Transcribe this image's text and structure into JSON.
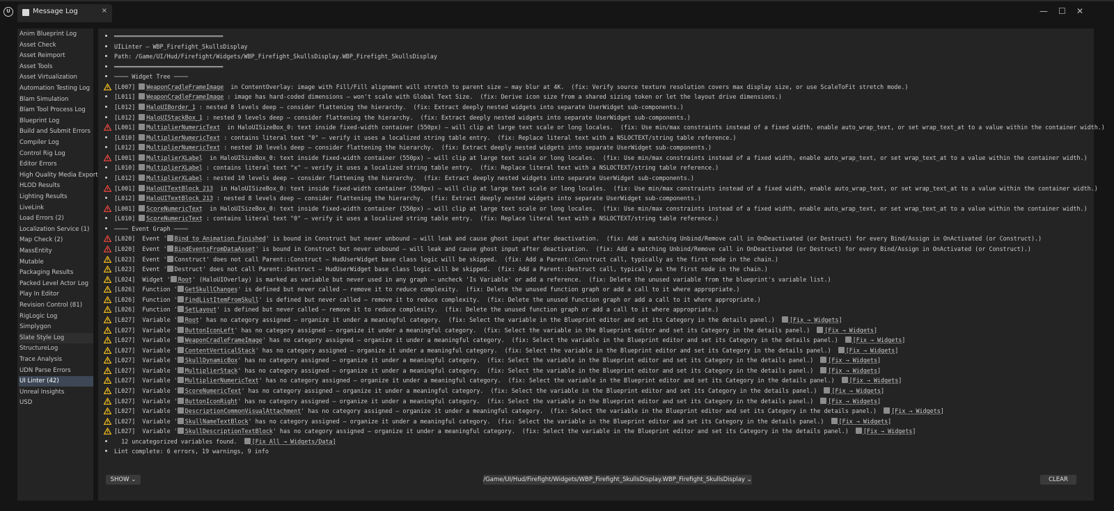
{
  "window": {
    "tab_title": "Message Log",
    "close_glyph": "×",
    "minimize_glyph": "—",
    "maximize_glyph": "☐",
    "window_close_glyph": "✕"
  },
  "sidebar": {
    "selected_index": 32,
    "hover_index": 28,
    "items": [
      "Anim Blueprint Log",
      "Asset Check",
      "Asset Reimport",
      "Asset Tools",
      "Asset Virtualization",
      "Automation Testing Log",
      "Blam Simulation",
      "Blam Tool Process Log",
      "Blueprint Log",
      "Build and Submit Errors",
      "Compiler Log",
      "Control Rig Log",
      "Editor Errors",
      "High Quality Media Export",
      "HLOD Results",
      "Lighting Results",
      "LiveLink",
      "Load Errors (2)",
      "Localization Service (1)",
      "Map Check (2)",
      "MassEntity",
      "Mutable",
      "Packaging Results",
      "Packed Level Actor Log",
      "Play In Editor",
      "Revision Control (81)",
      "RigLogic Log",
      "Simplygon",
      "Slate Style Log",
      "StructureLog",
      "Trace Analysis",
      "UDN Parse Errors",
      "UI Linter (42)",
      "Unreal Insights",
      "USD"
    ]
  },
  "colors": {
    "warning": "#e8b51c",
    "error": "#e0443a",
    "selected_bg": "#3d4756"
  },
  "log": {
    "lines": [
      {
        "t": "b",
        "segs": [
          {
            "x": "═══════════════════════════════"
          }
        ]
      },
      {
        "t": "b",
        "segs": [
          {
            "x": "UILinter — WBP_Firefight_SkullsDisplay"
          }
        ]
      },
      {
        "t": "b",
        "segs": [
          {
            "x": "Path: /Game/UI/Hud/Firefight/Widgets/WBP_Firefight_SkullsDisplay.WBP_Firefight_SkullsDisplay"
          }
        ]
      },
      {
        "t": "b",
        "segs": [
          {
            "x": "═══════════════════════════════"
          }
        ]
      },
      {
        "t": "b",
        "segs": [
          {
            "x": "──── Widget Tree ────"
          }
        ]
      },
      {
        "t": "w",
        "segs": [
          {
            "x": "[L007] "
          },
          {
            "i": 1
          },
          {
            "x": "WeaponCradleFrameImage",
            "u": 1
          },
          {
            "x": "  in ContentOverlay: image with Fill/Fill alignment will stretch to parent size — may blur at 4K.  (fix: Verify source texture resolution covers max display size, or use ScaleToFit stretch mode.)"
          }
        ]
      },
      {
        "t": "b",
        "segs": [
          {
            "x": "[L011] "
          },
          {
            "i": 1
          },
          {
            "x": "WeaponCradleFrameImage",
            "u": 1
          },
          {
            "x": " : image has hard-coded dimensions — won't scale with Global Text Size.  (fix: Derive icon size from a shared sizing token or let the layout drive dimensions.)"
          }
        ]
      },
      {
        "t": "b",
        "segs": [
          {
            "x": "[L012] "
          },
          {
            "i": 1
          },
          {
            "x": "HaloUIBorder_1",
            "u": 1
          },
          {
            "x": " : nested 8 levels deep — consider flattening the hierarchy.  (fix: Extract deeply nested widgets into separate UserWidget sub-components.)"
          }
        ]
      },
      {
        "t": "b",
        "segs": [
          {
            "x": "[L012] "
          },
          {
            "i": 1
          },
          {
            "x": "HaloUIStackBox_1",
            "u": 1
          },
          {
            "x": " : nested 9 levels deep — consider flattening the hierarchy.  (fix: Extract deeply nested widgets into separate UserWidget sub-components.)"
          }
        ]
      },
      {
        "t": "e",
        "segs": [
          {
            "x": "[L001] "
          },
          {
            "i": 1
          },
          {
            "x": "MultiplierNumericText",
            "u": 1
          },
          {
            "x": "  in HaloUISizeBox_0: text inside fixed-width container (550px) — will clip at large text scale or long locales.  (fix: Use min/max constraints instead of a fixed width, enable auto_wrap_text, or set wrap_text_at to a value within the container width.)"
          }
        ]
      },
      {
        "t": "b",
        "segs": [
          {
            "x": "[L010] "
          },
          {
            "i": 1
          },
          {
            "x": "MultiplierNumericText",
            "u": 1
          },
          {
            "x": " : contains literal text \"0\" — verify it uses a localized string table entry.  (fix: Replace literal text with a NSLOCTEXT/string table reference.)"
          }
        ]
      },
      {
        "t": "b",
        "segs": [
          {
            "x": "[L012] "
          },
          {
            "i": 1
          },
          {
            "x": "MultiplierNumericText",
            "u": 1
          },
          {
            "x": " : nested 10 levels deep — consider flattening the hierarchy.  (fix: Extract deeply nested widgets into separate UserWidget sub-components.)"
          }
        ]
      },
      {
        "t": "e",
        "segs": [
          {
            "x": "[L001] "
          },
          {
            "i": 1
          },
          {
            "x": "MultiplierXLabel",
            "u": 1
          },
          {
            "x": "  in HaloUISizeBox_0: text inside fixed-width container (550px) — will clip at large text scale or long locales.  (fix: Use min/max constraints instead of a fixed width, enable auto_wrap_text, or set wrap_text_at to a value within the container width.)"
          }
        ]
      },
      {
        "t": "b",
        "segs": [
          {
            "x": "[L010] "
          },
          {
            "i": 1
          },
          {
            "x": "MultiplierXLabel",
            "u": 1
          },
          {
            "x": " : contains literal text \"x\" — verify it uses a localized string table entry.  (fix: Replace literal text with a NSLOCTEXT/string table reference.)"
          }
        ]
      },
      {
        "t": "b",
        "segs": [
          {
            "x": "[L012] "
          },
          {
            "i": 1
          },
          {
            "x": "MultiplierXLabel",
            "u": 1
          },
          {
            "x": " : nested 10 levels deep — consider flattening the hierarchy.  (fix: Extract deeply nested widgets into separate UserWidget sub-components.)"
          }
        ]
      },
      {
        "t": "e",
        "segs": [
          {
            "x": "[L001] "
          },
          {
            "i": 1
          },
          {
            "x": "HaloUITextBlock_213",
            "u": 1
          },
          {
            "x": "  in HaloUISizeBox_0: text inside fixed-width container (550px) — will clip at large text scale or long locales.  (fix: Use min/max constraints instead of a fixed width, enable auto_wrap_text, or set wrap_text_at to a value within the container width.)"
          }
        ]
      },
      {
        "t": "b",
        "segs": [
          {
            "x": "[L012] "
          },
          {
            "i": 1
          },
          {
            "x": "HaloUITextBlock_213",
            "u": 1
          },
          {
            "x": " : nested 8 levels deep — consider flattening the hierarchy.  (fix: Extract deeply nested widgets into separate UserWidget sub-components.)"
          }
        ]
      },
      {
        "t": "e",
        "segs": [
          {
            "x": "[L001] "
          },
          {
            "i": 1
          },
          {
            "x": "ScoreNumericText",
            "u": 1
          },
          {
            "x": "  in HaloUISizeBox_0: text inside fixed-width container (550px) — will clip at large text scale or long locales.  (fix: Use min/max constraints instead of a fixed width, enable auto_wrap_text, or set wrap_text_at to a value within the container width.)"
          }
        ]
      },
      {
        "t": "b",
        "segs": [
          {
            "x": "[L010] "
          },
          {
            "i": 1
          },
          {
            "x": "ScoreNumericText",
            "u": 1
          },
          {
            "x": " : contains literal text \"0\" — verify it uses a localized string table entry.  (fix: Replace literal text with a NSLOCTEXT/string table reference.)"
          }
        ]
      },
      {
        "t": "b",
        "segs": [
          {
            "x": "──── Event Graph ────"
          }
        ]
      },
      {
        "t": "e",
        "segs": [
          {
            "x": "[L020]  Event '"
          },
          {
            "i": 1
          },
          {
            "x": "Bind to Animation Finished",
            "u": 1
          },
          {
            "x": "' is bound in Construct but never unbound — will leak and cause ghost input after deactivation.  (fix: Add a matching Unbind/Remove call in OnDeactivated (or Destruct) for every Bind/Assign in OnActivated (or Construct).)"
          }
        ]
      },
      {
        "t": "e",
        "segs": [
          {
            "x": "[L020]  Event '"
          },
          {
            "i": 1
          },
          {
            "x": "BindEventsFromDataAsset",
            "u": 1
          },
          {
            "x": "' is bound in Construct but never unbound — will leak and cause ghost input after deactivation.  (fix: Add a matching Unbind/Remove call in OnDeactivated (or Destruct) for every Bind/Assign in OnActivated (or Construct).)"
          }
        ]
      },
      {
        "t": "w",
        "segs": [
          {
            "x": "[L023]  Event '"
          },
          {
            "i": 1
          },
          {
            "x": "Construct' does not call Parent::Construct — HudUserWidget base class logic will be skipped.  (fix: Add a Parent::Construct call, typically as the first node in the chain.)"
          }
        ]
      },
      {
        "t": "w",
        "segs": [
          {
            "x": "[L023]  Event '"
          },
          {
            "i": 1
          },
          {
            "x": "Destruct' does not call Parent::Destruct — HudUserWidget base class logic will be skipped.  (fix: Add a Parent::Destruct call, typically as the first node in the chain.)"
          }
        ]
      },
      {
        "t": "w",
        "segs": [
          {
            "x": "[L024]  Widget '"
          },
          {
            "i": 1
          },
          {
            "x": "Root",
            "u": 1
          },
          {
            "x": "' (HaloUIOverlay) is marked as variable but never used in any graph — uncheck 'Is Variable' or add a reference.  (fix: Delete the unused variable from the blueprint's variable list.)"
          }
        ]
      },
      {
        "t": "w",
        "segs": [
          {
            "x": "[L026]  Function '"
          },
          {
            "i": 1
          },
          {
            "x": "GetSkullChanges",
            "u": 1
          },
          {
            "x": "' is defined but never called — remove it to reduce complexity.  (fix: Delete the unused function graph or add a call to it where appropriate.)"
          }
        ]
      },
      {
        "t": "w",
        "segs": [
          {
            "x": "[L026]  Function '"
          },
          {
            "i": 1
          },
          {
            "x": "FindListItemFromSkull",
            "u": 1
          },
          {
            "x": "' is defined but never called — remove it to reduce complexity.  (fix: Delete the unused function graph or add a call to it where appropriate.)"
          }
        ]
      },
      {
        "t": "w",
        "segs": [
          {
            "x": "[L026]  Function '"
          },
          {
            "i": 1
          },
          {
            "x": "SetLayout",
            "u": 1
          },
          {
            "x": "' is defined but never called — remove it to reduce complexity.  (fix: Delete the unused function graph or add a call to it where appropriate.)"
          }
        ]
      },
      {
        "t": "w",
        "segs": [
          {
            "x": "[L027]  Variable '"
          },
          {
            "i": 1
          },
          {
            "x": "Root",
            "u": 1
          },
          {
            "x": "' has no category assigned — organize it under a meaningful category.  (fix: Select the variable in the Blueprint editor and set its Category in the details panel.)  "
          },
          {
            "i": 1
          },
          {
            "x": "[Fix → Widgets]",
            "l": 1
          }
        ]
      },
      {
        "t": "w",
        "segs": [
          {
            "x": "[L027]  Variable '"
          },
          {
            "i": 1
          },
          {
            "x": "ButtonIconLeft",
            "u": 1
          },
          {
            "x": "' has no category assigned — organize it under a meaningful category.  (fix: Select the variable in the Blueprint editor and set its Category in the details panel.)  "
          },
          {
            "i": 1
          },
          {
            "x": "[Fix → Widgets]",
            "l": 1
          }
        ]
      },
      {
        "t": "w",
        "segs": [
          {
            "x": "[L027]  Variable '"
          },
          {
            "i": 1
          },
          {
            "x": "WeaponCradleFrameImage",
            "u": 1
          },
          {
            "x": "' has no category assigned — organize it under a meaningful category.  (fix: Select the variable in the Blueprint editor and set its Category in the details panel.)  "
          },
          {
            "i": 1
          },
          {
            "x": "[Fix → Widgets]",
            "l": 1
          }
        ]
      },
      {
        "t": "w",
        "segs": [
          {
            "x": "[L027]  Variable '"
          },
          {
            "i": 1
          },
          {
            "x": "ContentVerticalStack",
            "u": 1
          },
          {
            "x": "' has no category assigned — organize it under a meaningful category.  (fix: Select the variable in the Blueprint editor and set its Category in the details panel.)  "
          },
          {
            "i": 1
          },
          {
            "x": "[Fix → Widgets]",
            "l": 1
          }
        ]
      },
      {
        "t": "w",
        "segs": [
          {
            "x": "[L027]  Variable '"
          },
          {
            "i": 1
          },
          {
            "x": "SkullDynamicBox",
            "u": 1
          },
          {
            "x": "' has no category assigned — organize it under a meaningful category.  (fix: Select the variable in the Blueprint editor and set its Category in the details panel.)  "
          },
          {
            "i": 1
          },
          {
            "x": "[Fix → Widgets]",
            "l": 1
          }
        ]
      },
      {
        "t": "w",
        "segs": [
          {
            "x": "[L027]  Variable '"
          },
          {
            "i": 1
          },
          {
            "x": "MultiplierStack",
            "u": 1
          },
          {
            "x": "' has no category assigned — organize it under a meaningful category.  (fix: Select the variable in the Blueprint editor and set its Category in the details panel.)  "
          },
          {
            "i": 1
          },
          {
            "x": "[Fix → Widgets]",
            "l": 1
          }
        ]
      },
      {
        "t": "w",
        "segs": [
          {
            "x": "[L027]  Variable '"
          },
          {
            "i": 1
          },
          {
            "x": "MultiplierNumericText",
            "u": 1
          },
          {
            "x": "' has no category assigned — organize it under a meaningful category.  (fix: Select the variable in the Blueprint editor and set its Category in the details panel.)  "
          },
          {
            "i": 1
          },
          {
            "x": "[Fix → Widgets]",
            "l": 1
          }
        ]
      },
      {
        "t": "w",
        "segs": [
          {
            "x": "[L027]  Variable '"
          },
          {
            "i": 1
          },
          {
            "x": "ScoreNumericText",
            "u": 1
          },
          {
            "x": "' has no category assigned — organize it under a meaningful category.  (fix: Select the variable in the Blueprint editor and set its Category in the details panel.)  "
          },
          {
            "i": 1
          },
          {
            "x": "[Fix → Widgets]",
            "l": 1
          }
        ]
      },
      {
        "t": "w",
        "segs": [
          {
            "x": "[L027]  Variable '"
          },
          {
            "i": 1
          },
          {
            "x": "ButtonIconRight",
            "u": 1
          },
          {
            "x": "' has no category assigned — organize it under a meaningful category.  (fix: Select the variable in the Blueprint editor and set its Category in the details panel.)  "
          },
          {
            "i": 1
          },
          {
            "x": "[Fix → Widgets]",
            "l": 1
          }
        ]
      },
      {
        "t": "w",
        "segs": [
          {
            "x": "[L027]  Variable '"
          },
          {
            "i": 1
          },
          {
            "x": "DescriptionCommonVisualAttachment",
            "u": 1
          },
          {
            "x": "' has no category assigned — organize it under a meaningful category.  (fix: Select the variable in the Blueprint editor and set its Category in the details panel.)  "
          },
          {
            "i": 1
          },
          {
            "x": "[Fix → Widgets]",
            "l": 1
          }
        ]
      },
      {
        "t": "w",
        "segs": [
          {
            "x": "[L027]  Variable '"
          },
          {
            "i": 1
          },
          {
            "x": "SkullNameTextBlock",
            "u": 1
          },
          {
            "x": "' has no category assigned — organize it under a meaningful category.  (fix: Select the variable in the Blueprint editor and set its Category in the details panel.)  "
          },
          {
            "i": 1
          },
          {
            "x": "[Fix → Widgets]",
            "l": 1
          }
        ]
      },
      {
        "t": "w",
        "segs": [
          {
            "x": "[L027]  Variable '"
          },
          {
            "i": 1
          },
          {
            "x": "SkullDescriptionTextBlock",
            "u": 1
          },
          {
            "x": "' has no category assigned — organize it under a meaningful category.  (fix: Select the variable in the Blueprint editor and set its Category in the details panel.)  "
          },
          {
            "i": 1
          },
          {
            "x": "[Fix → Widgets]",
            "l": 1
          }
        ]
      },
      {
        "t": "b",
        "segs": [
          {
            "x": "  12 uncategorized variables found.  "
          },
          {
            "i": 1
          },
          {
            "x": "[Fix All → Widgets/Data]",
            "l": 1
          }
        ]
      },
      {
        "t": "b",
        "segs": [
          {
            "x": "Lint complete: 6 errors, 19 warnings, 9 info"
          }
        ]
      }
    ]
  },
  "footer": {
    "show_label": "SHOW",
    "path_label": "/Game/UI/Hud/Firefight/Widgets/WBP_Firefight_SkullsDisplay.WBP_Firefight_SkullsDisplay",
    "clear_label": "CLEAR",
    "dropdown_glyph": "⌄"
  }
}
